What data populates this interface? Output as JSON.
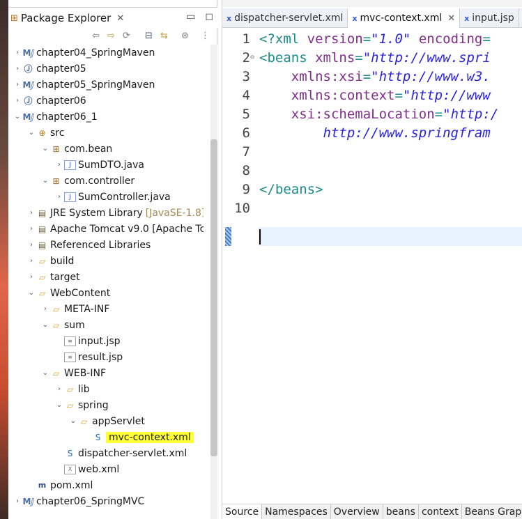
{
  "explorer": {
    "title": "Package Explorer",
    "close_glyph": "✕",
    "rows": [
      {
        "label": "chapter04_SpringMaven",
        "icon": "maven-project-icon",
        "indent": 0,
        "arrow": "›"
      },
      {
        "label": "chapter05",
        "icon": "java-project-icon",
        "indent": 0,
        "arrow": "›"
      },
      {
        "label": "chapter05_SpringMaven",
        "icon": "maven-project-icon",
        "indent": 0,
        "arrow": "›"
      },
      {
        "label": "chapter06",
        "icon": "java-project-icon",
        "indent": 0,
        "arrow": "›"
      },
      {
        "label": "chapter06_1",
        "icon": "maven-project-icon",
        "indent": 0,
        "arrow": "⌄"
      },
      {
        "label": "src",
        "icon": "source-folder-icon",
        "indent": 1,
        "arrow": "⌄"
      },
      {
        "label": "com.bean",
        "icon": "package-icon",
        "indent": 2,
        "arrow": "⌄"
      },
      {
        "label": "SumDTO.java",
        "icon": "java-file-icon",
        "indent": 3,
        "arrow": "›"
      },
      {
        "label": "com.controller",
        "icon": "package-icon",
        "indent": 2,
        "arrow": "⌄"
      },
      {
        "label": "SumController.java",
        "icon": "java-file-icon",
        "indent": 3,
        "arrow": "›"
      },
      {
        "label": "JRE System Library",
        "suffix": "[JavaSE-1.8]",
        "icon": "library-icon",
        "indent": 1,
        "arrow": "›"
      },
      {
        "label": "Apache Tomcat v9.0 [Apache Tc",
        "icon": "library-icon",
        "indent": 1,
        "arrow": "›"
      },
      {
        "label": "Referenced Libraries",
        "icon": "library-icon",
        "indent": 1,
        "arrow": "›"
      },
      {
        "label": "build",
        "icon": "folder-icon",
        "indent": 1,
        "arrow": "›"
      },
      {
        "label": "target",
        "icon": "folder-icon",
        "indent": 1,
        "arrow": "›"
      },
      {
        "label": "WebContent",
        "icon": "folder-icon",
        "indent": 1,
        "arrow": "⌄"
      },
      {
        "label": "META-INF",
        "icon": "folder-icon",
        "indent": 2,
        "arrow": "›"
      },
      {
        "label": "sum",
        "icon": "folder-icon",
        "indent": 2,
        "arrow": "⌄"
      },
      {
        "label": "input.jsp",
        "icon": "jsp-file-icon",
        "indent": 3,
        "arrow": ""
      },
      {
        "label": "result.jsp",
        "icon": "jsp-file-icon",
        "indent": 3,
        "arrow": ""
      },
      {
        "label": "WEB-INF",
        "icon": "folder-icon",
        "indent": 2,
        "arrow": "⌄"
      },
      {
        "label": "lib",
        "icon": "folder-icon",
        "indent": 3,
        "arrow": "›"
      },
      {
        "label": "spring",
        "icon": "folder-icon",
        "indent": 3,
        "arrow": "⌄"
      },
      {
        "label": "appServlet",
        "icon": "folder-icon",
        "indent": 4,
        "arrow": "⌄"
      },
      {
        "label": "mvc-context.xml",
        "icon": "spring-xml-icon",
        "indent": 5,
        "arrow": "",
        "highlight": true
      },
      {
        "label": "dispatcher-servlet.xml",
        "icon": "spring-xml-icon",
        "indent": 3,
        "arrow": ""
      },
      {
        "label": "web.xml",
        "icon": "xml-file-icon",
        "indent": 3,
        "arrow": ""
      },
      {
        "label": "pom.xml",
        "icon": "pom-file-icon",
        "indent": 1,
        "arrow": ""
      },
      {
        "label": "chapter06_SpringMVC",
        "icon": "maven-project-icon",
        "indent": 0,
        "arrow": "›"
      }
    ]
  },
  "editor": {
    "tabs": [
      {
        "label": "dispatcher-servlet.xml",
        "active": false
      },
      {
        "label": "mvc-context.xml",
        "active": true,
        "close": "✕"
      },
      {
        "label": "input.jsp",
        "active": false
      }
    ],
    "lines": [
      {
        "num": "1",
        "parts": [
          {
            "t": "<?xml ",
            "c": "tag"
          },
          {
            "t": "version",
            "c": "attr"
          },
          {
            "t": "=",
            "c": "plain"
          },
          {
            "t": "\"1.0\"",
            "c": "val"
          },
          {
            "t": " encoding",
            "c": "attr"
          },
          {
            "t": "=",
            "c": "plain"
          }
        ]
      },
      {
        "num": "2",
        "fold": "⊖",
        "parts": [
          {
            "t": "<beans ",
            "c": "tag"
          },
          {
            "t": "xmlns",
            "c": "attr"
          },
          {
            "t": "=",
            "c": "plain"
          },
          {
            "t": "\"http://www.spri",
            "c": "val"
          }
        ]
      },
      {
        "num": "3",
        "parts": [
          {
            "t": "    xmlns:xsi",
            "c": "attr"
          },
          {
            "t": "=",
            "c": "plain"
          },
          {
            "t": "\"http://www.w3.",
            "c": "val"
          }
        ]
      },
      {
        "num": "4",
        "parts": [
          {
            "t": "    xmlns:context",
            "c": "attr"
          },
          {
            "t": "=",
            "c": "plain"
          },
          {
            "t": "\"http://www",
            "c": "val"
          }
        ]
      },
      {
        "num": "5",
        "parts": [
          {
            "t": "    xsi:schemaLocation",
            "c": "attr"
          },
          {
            "t": "=",
            "c": "plain"
          },
          {
            "t": "\"http:/",
            "c": "val"
          }
        ]
      },
      {
        "num": "6",
        "parts": [
          {
            "t": "        http://www.springfram",
            "c": "val"
          }
        ]
      },
      {
        "num": "7",
        "parts": []
      },
      {
        "num": "8",
        "parts": []
      },
      {
        "num": "9",
        "parts": [
          {
            "t": "</beans>",
            "c": "tag"
          }
        ]
      },
      {
        "num": "10",
        "parts": []
      }
    ],
    "bottom_tabs": [
      "Source",
      "Namespaces",
      "Overview",
      "beans",
      "context",
      "Beans Graph"
    ]
  }
}
